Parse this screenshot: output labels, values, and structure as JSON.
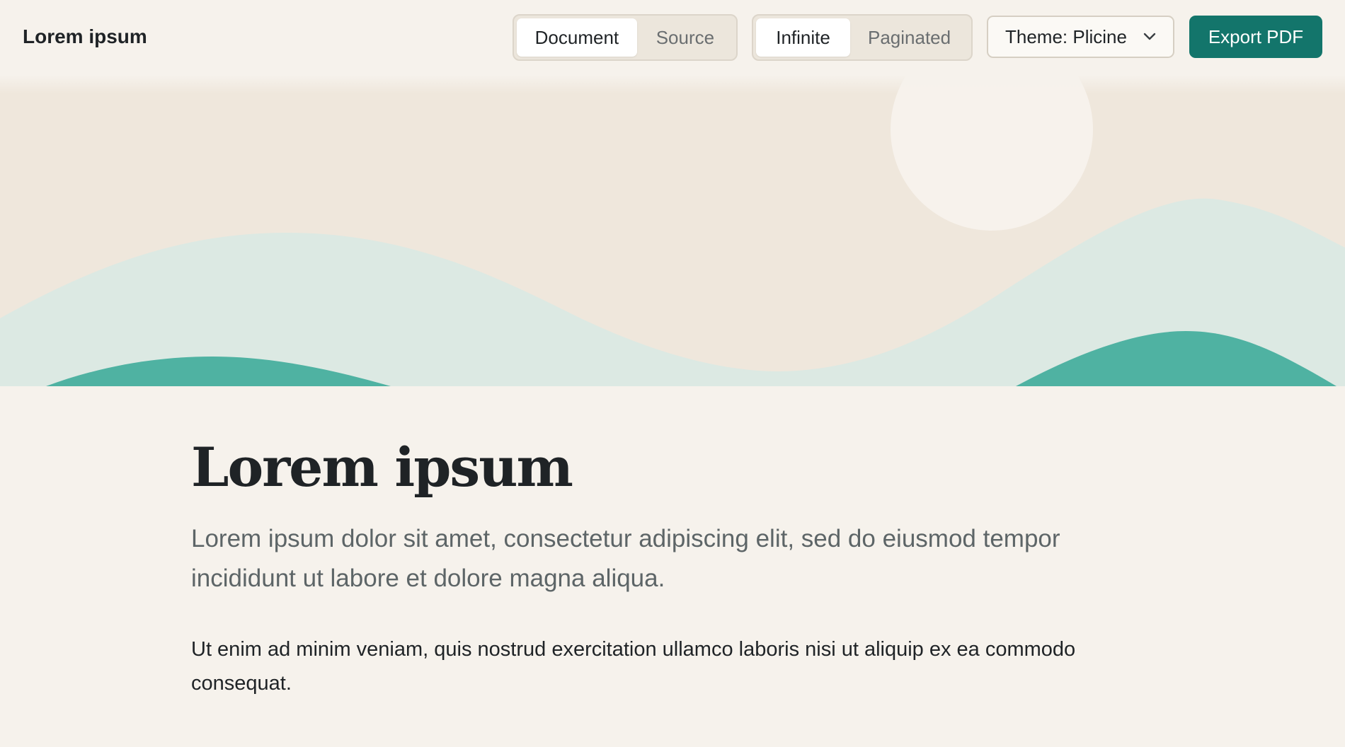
{
  "app": {
    "title": "Lorem ipsum"
  },
  "view_toggle": {
    "options": [
      {
        "label": "Document",
        "active": true
      },
      {
        "label": "Source",
        "active": false
      }
    ]
  },
  "layout_toggle": {
    "options": [
      {
        "label": "Infinite",
        "active": true
      },
      {
        "label": "Paginated",
        "active": false
      }
    ]
  },
  "theme_select": {
    "label": "Theme: Plicine",
    "icon": "chevron-down-icon"
  },
  "export_button": {
    "label": "Export PDF"
  },
  "colors": {
    "background": "#f6f2ec",
    "hero_sky": "#efe7dc",
    "hero_sun": "#f7f2ec",
    "hero_hill_light": "#dce9e3",
    "hero_hill_dark": "#4fb2a2",
    "accent": "#13756b"
  },
  "document": {
    "title": "Lorem ipsum",
    "lead": "Lorem ipsum dolor sit amet, consectetur adipiscing elit, sed do eiusmod tempor incididunt ut labore et dolore magna aliqua.",
    "body": "Ut enim ad minim veniam, quis nostrud exercitation ullamco laboris nisi ut aliquip ex ea commodo consequat."
  }
}
